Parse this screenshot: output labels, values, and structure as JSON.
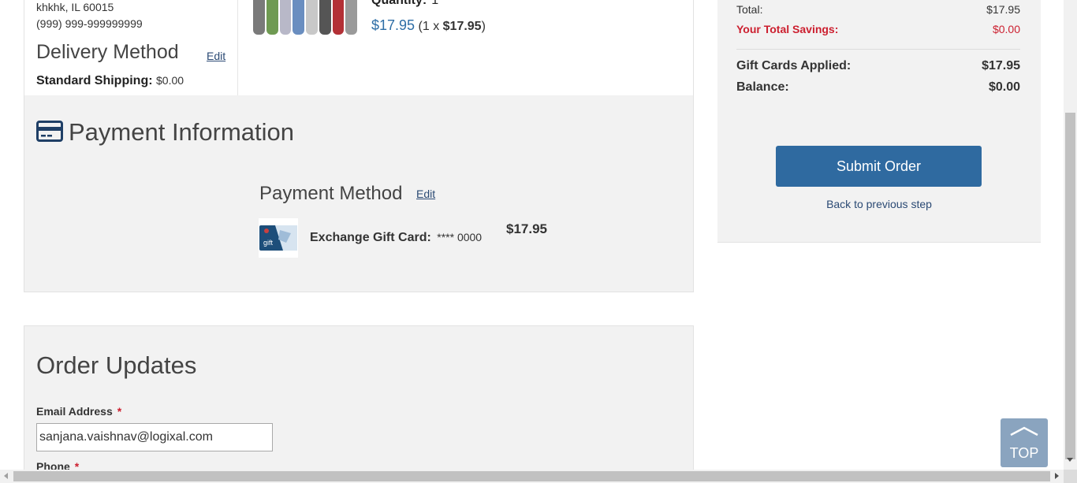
{
  "address": {
    "city_line": "khkhk, IL 60015",
    "phone_line": "(999)  999-999999999"
  },
  "delivery": {
    "title": "Delivery Method",
    "edit_label": "Edit",
    "shipping_label": "Standard Shipping:",
    "shipping_value": "$0.00"
  },
  "product": {
    "quantity_label": "Quantity:",
    "quantity_value": "1",
    "price": "$17.95",
    "unit_prefix": "(1 x",
    "unit_price": "$17.95",
    "unit_suffix": ")",
    "thumb_colors": [
      "#7a7a7a",
      "#6f9a52",
      "#b8b8c8",
      "#6a8ec0",
      "#c8c8c8",
      "#555",
      "#b33036",
      "#9a9a9a"
    ]
  },
  "payment": {
    "title": "Payment Information",
    "method_title": "Payment Method",
    "method_edit_label": "Edit",
    "card_name": "Exchange Gift Card:",
    "card_mask": "**** 0000",
    "amount": "$17.95",
    "gift_card_text": "gift"
  },
  "order_updates": {
    "title": "Order Updates",
    "email_label": "Email Address",
    "email_value": "sanjana.vaishnav@logixal.com",
    "phone_label": "Phone",
    "required_mark": "*"
  },
  "summary": {
    "total_label": "Total:",
    "total_value": "$17.95",
    "savings_label": "Your Total Savings:",
    "savings_value": "$0.00",
    "gift_applied_label": "Gift Cards Applied:",
    "gift_applied_value": "$17.95",
    "balance_label": "Balance:",
    "balance_value": "$0.00",
    "submit_label": "Submit Order",
    "back_label": "Back to previous step"
  },
  "top_button": {
    "label": "TOP"
  },
  "colors": {
    "accent": "#2f6aa0",
    "link": "#2b4a74",
    "savings": "#cc1f2f",
    "panel_bg": "#f2f2f2"
  }
}
